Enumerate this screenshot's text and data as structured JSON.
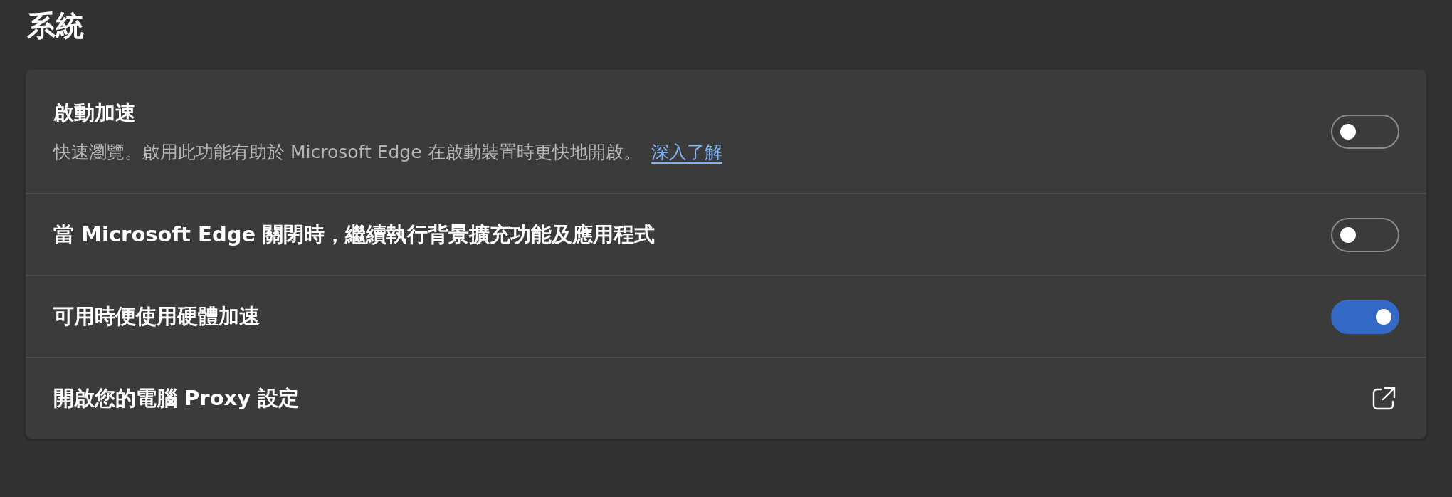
{
  "title": "系統",
  "settings": [
    {
      "kind": "toggle",
      "label": "啟動加速",
      "description": "快速瀏覽。啟用此功能有助於 Microsoft Edge 在啟動裝置時更快地開啟。",
      "link": "深入了解",
      "on": false
    },
    {
      "kind": "toggle",
      "label": "當 Microsoft Edge 關閉時，繼續執行背景擴充功能及應用程式",
      "on": false
    },
    {
      "kind": "toggle",
      "label": "可用時便使用硬體加速",
      "on": true
    },
    {
      "kind": "external",
      "label": "開啟您的電腦 Proxy 設定"
    }
  ]
}
